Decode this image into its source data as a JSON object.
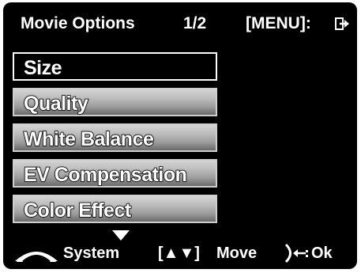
{
  "header": {
    "title": "Movie Options",
    "page_indicator": "1/2",
    "menu_hint": "[MENU]:",
    "exit_icon": "exit-arrow-icon"
  },
  "menu": {
    "items": [
      {
        "label": "Size",
        "selected": true
      },
      {
        "label": "Quality",
        "selected": false
      },
      {
        "label": "White Balance",
        "selected": false
      },
      {
        "label": "EV Compensation",
        "selected": false
      },
      {
        "label": "Color Effect",
        "selected": false
      }
    ]
  },
  "footer": {
    "system_label": "System",
    "move_keys": "[▲▼]",
    "move_label": "Move",
    "ok_label": "Ok",
    "icons": [
      "dial-icon",
      "scroll-down-arrow-icon",
      "ok-button-icon"
    ]
  },
  "colors": {
    "background": "#000000",
    "text": "#ffffff",
    "item_gradient_top": "#d4d4d4",
    "item_gradient_bottom": "#6a6a6a"
  }
}
